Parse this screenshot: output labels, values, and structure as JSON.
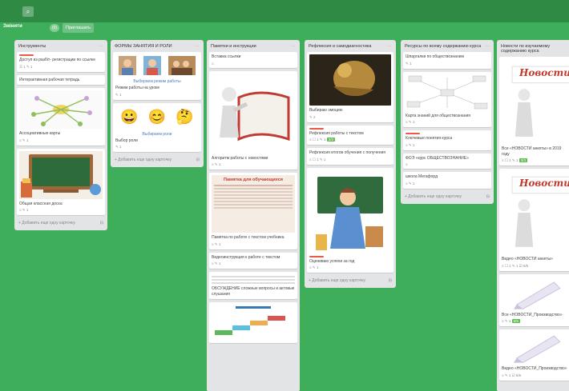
{
  "topbar": {
    "search_icon": "search-icon"
  },
  "subbar": {
    "board_title": "Змінити",
    "members_count": "(0)",
    "share_label": "Приглашать"
  },
  "lists": [
    {
      "title": "Инструменты",
      "cards": [
        {
          "title": "Доступ из разбіт- регистрации по ссылке",
          "icons": "☰ 1  ✎ 1",
          "label": true
        },
        {
          "title": "Интерактивная рабочая тетрадь",
          "icons": ""
        },
        {
          "title": "Ассоциативные карты",
          "icons": "≡  ✎ 1"
        },
        {
          "title": "Общая классная доска",
          "icons": "≡  ✎ 1"
        }
      ],
      "add": "+ Добавить еще одну карточку"
    },
    {
      "title": "ФОРМЫ ЗАНЯТИЯ И РОЛИ",
      "cards": [
        {
          "title": "Режим работы на уроке",
          "caption": "Выбираем режим работы",
          "icons": "✎ 1"
        },
        {
          "title": "Выбор роли",
          "caption": "Выбираем роли",
          "icons": "✎ 1"
        }
      ],
      "add": "+ Добавить еще одну карточку"
    },
    {
      "title": "Памятки и инструкции",
      "cards": [
        {
          "title": "Вставка ссылки",
          "icons": "≡"
        },
        {
          "title": "Алгоритм работы с новостями",
          "icons": "≡  ✎ 1"
        },
        {
          "title": "Памятка по работе с текстом учебника",
          "icons": "≡  ✎ 1",
          "poster": "Памятка для обучающихся"
        },
        {
          "title": "Видеоинструкция к работе с текстом",
          "icons": "≡  ✎ 1"
        },
        {
          "title": "ОБСУЖДЕНИЕ сложные вопросы и актовые слушания",
          "icons": ""
        }
      ]
    },
    {
      "title": "Рефлексия и самодиагностика",
      "cards": [
        {
          "title": "Выбираю эмоцию",
          "icons": "✎ 2"
        },
        {
          "title": "Рефлексия работы с текстом",
          "icons": "≡  ☐ 1  ✎ 1",
          "badge": "3/3",
          "label": true
        },
        {
          "title": "Рефлексия итогов обучения с получения",
          "icons": "≡  ☐ 1  ✎ 1"
        },
        {
          "title": "Оцениваю успехи за год",
          "icons": "≡  ✎ 1",
          "label": true
        }
      ],
      "add": "+ Добавить еще одну карточку"
    },
    {
      "title": "Ресурсы по всему содержанию курса",
      "cards": [
        {
          "title": "Шпаргалки по обществознанию",
          "icons": "✎ 1"
        },
        {
          "title": "Карта знаний для обществознания",
          "icons": "≡  ✎ 1"
        },
        {
          "title": "Ключевые понятия курса",
          "icons": "≡  ✎ 1",
          "label": true
        },
        {
          "title": "ФОЭ «курс ОБЩЕСТВОЗНАНИЕ»",
          "icons": "≡"
        },
        {
          "title": "школа Мегафорд",
          "icons": "≡  ✎ 1"
        }
      ],
      "add": "+ Добавить еще одну карточку"
    },
    {
      "title": "Новости по изучаемому содержанию курса",
      "cards": [
        {
          "title": "Все «НОВОСТИ анкеты» в 2019 году",
          "icons": "≡  ☐ 1  ✎ 1",
          "badge": "3/3",
          "poster": "Новости"
        },
        {
          "title": "Видео «НОВОСТИ анкеты»",
          "icons": "≡  ☐ 1  ✎ 1  ☑ 5/5",
          "poster": "Новости"
        },
        {
          "title": "Все «НОВОСТИ_Производство»",
          "icons": "≡  ✎ 1",
          "badge": "5/5"
        },
        {
          "title": "Видео «НОВОСТИ_Производство»",
          "icons": "≡  ✎ 1  ☑ 5/5"
        }
      ]
    }
  ]
}
